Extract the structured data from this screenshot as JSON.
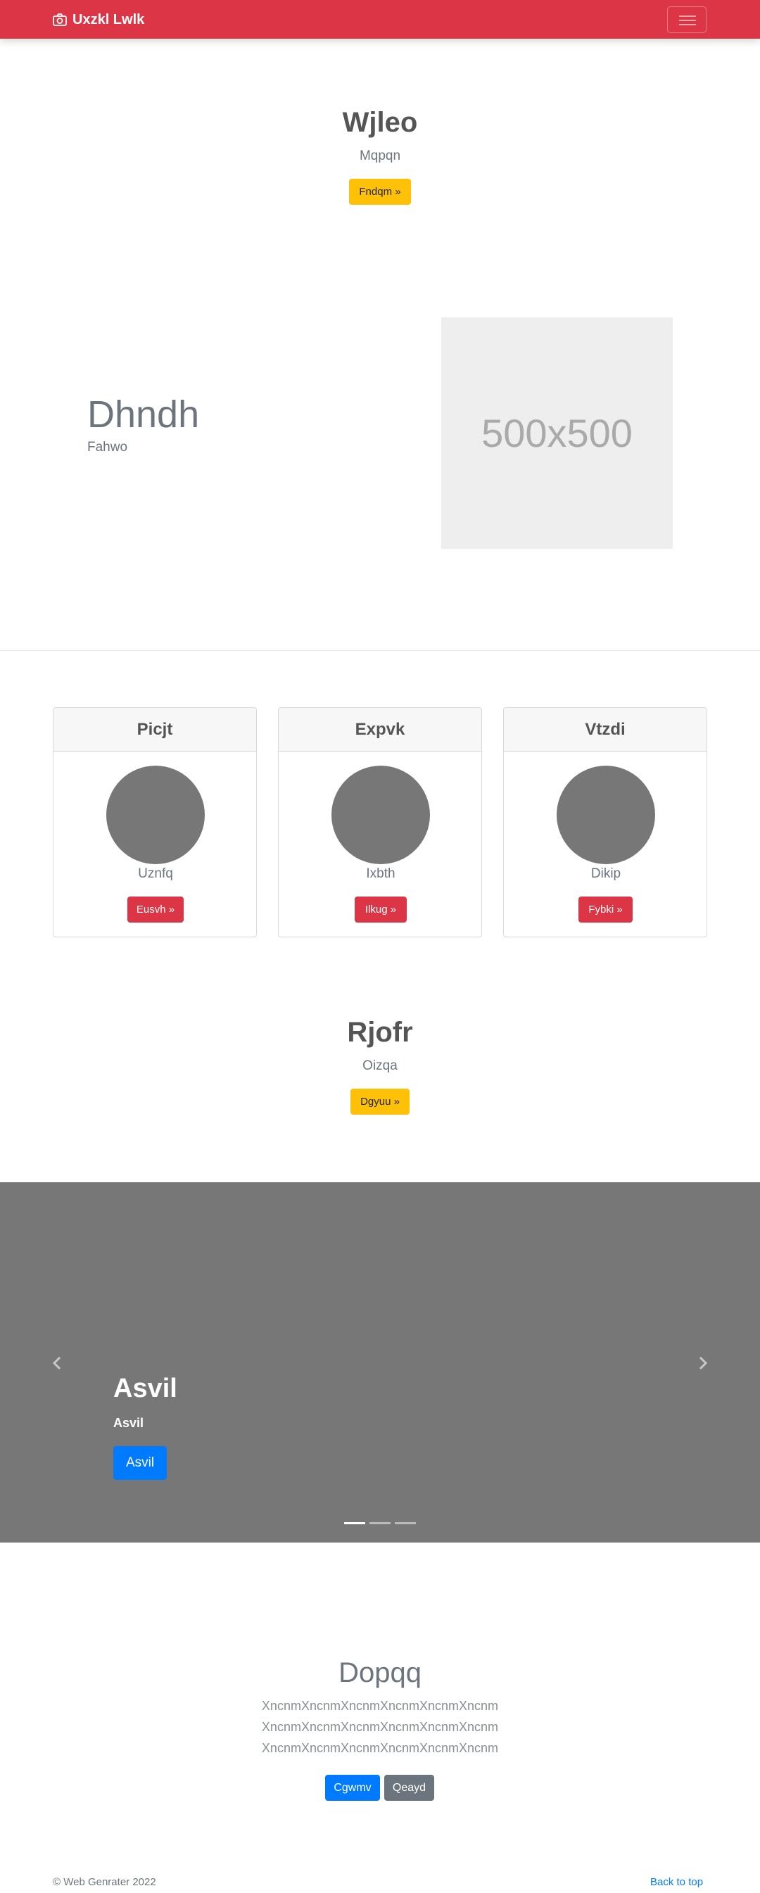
{
  "navbar": {
    "brand": "Uxzkl Lwlk",
    "bg_color": "#dc3545",
    "brand_icon": "camera-icon",
    "toggler_icon": "hamburger-icon"
  },
  "hero": {
    "title": "Wjleo",
    "subtitle": "Mqpqn",
    "button": "Fndqm »"
  },
  "feature": {
    "title": "Dhndh",
    "subtitle": "Fahwo",
    "image_text": "500x500"
  },
  "cards": [
    {
      "header": "Picjt",
      "text": "Uznfq",
      "button": "Eusvh »"
    },
    {
      "header": "Expvk",
      "text": "Ixbth",
      "button": "Ilkug »"
    },
    {
      "header": "Vtzdi",
      "text": "Dikip",
      "button": "Fybki »"
    }
  ],
  "hero2": {
    "title": "Rjofr",
    "subtitle": "Oizqa",
    "button": "Dgyuu »"
  },
  "carousel": {
    "title": "Asvil",
    "subtitle": "Asvil",
    "button": "Asvil",
    "prev_icon": "chevron-left-icon",
    "next_icon": "chevron-right-icon",
    "slide_count": 3,
    "active_slide": 1
  },
  "section": {
    "title": "Dopqq",
    "lines": [
      "XncnmXncnmXncnmXncnmXncnmXncnm",
      "XncnmXncnmXncnmXncnmXncnmXncnm",
      "XncnmXncnmXncnmXncnmXncnmXncnm"
    ],
    "primary_button": "Cgwmv",
    "secondary_button": "Qeayd"
  },
  "footer": {
    "copyright": "© Web Genrater 2022",
    "back_to_top": "Back to top"
  }
}
